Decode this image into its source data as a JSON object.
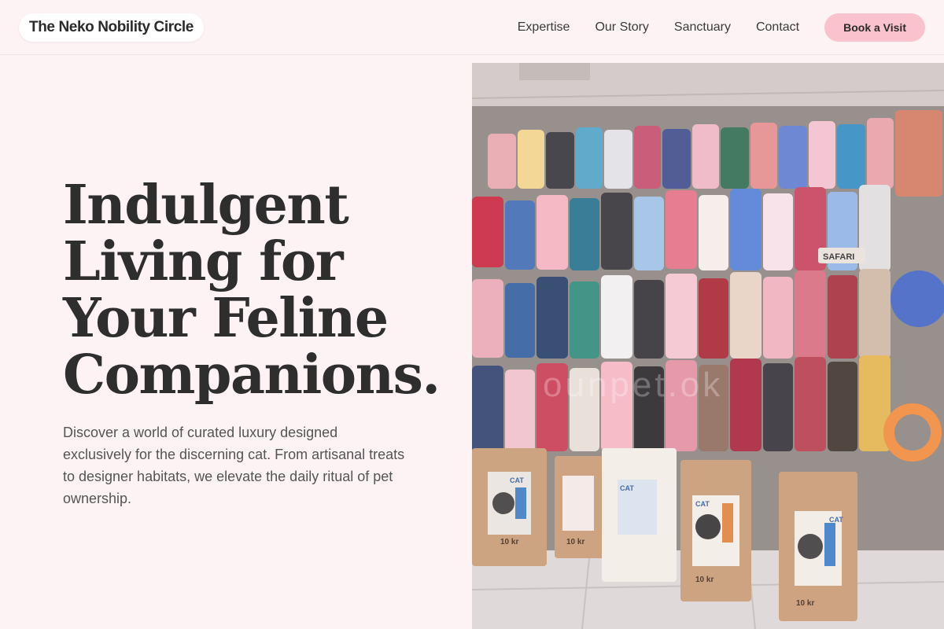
{
  "header": {
    "logo_text": "The Neko Nobility Circle",
    "nav": [
      {
        "label": "Expertise"
      },
      {
        "label": "Our Story"
      },
      {
        "label": "Sanctuary"
      },
      {
        "label": "Contact"
      }
    ],
    "cta_label": "Book a Visit"
  },
  "hero": {
    "title": "Indulgent Living for Your Feline Companions.",
    "description": "Discover a world of curated luxury designed exclusively for the discerning cat. From artisanal treats to designer habitats, we elevate the daily ritual of pet ownership.",
    "image": {
      "watermark_text": "ounpet.ok",
      "bag_labels": [
        "CAT",
        "CAT",
        "CAT",
        "CAT"
      ],
      "bag_weights": [
        "10 kr",
        "10 kr",
        "10 kr",
        "10 kr"
      ],
      "sign_text": "SAFARI"
    }
  },
  "colors": {
    "background": "#fdf2f4",
    "accent": "#f9c2cc",
    "text": "#2b2b2b"
  }
}
